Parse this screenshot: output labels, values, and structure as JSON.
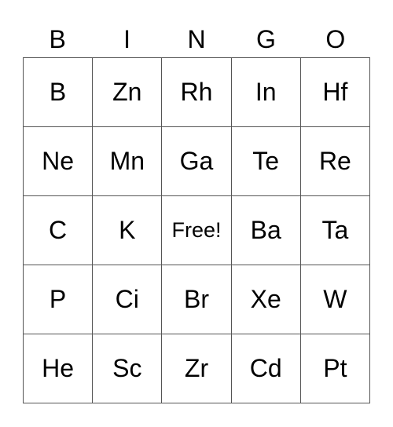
{
  "header": [
    "B",
    "I",
    "N",
    "G",
    "O"
  ],
  "board": [
    [
      "B",
      "Zn",
      "Rh",
      "In",
      "Hf"
    ],
    [
      "Ne",
      "Mn",
      "Ga",
      "Te",
      "Re"
    ],
    [
      "C",
      "K",
      "Free!",
      "Ba",
      "Ta"
    ],
    [
      "P",
      "Ci",
      "Br",
      "Xe",
      "W"
    ],
    [
      "He",
      "Sc",
      "Zr",
      "Cd",
      "Pt"
    ]
  ]
}
